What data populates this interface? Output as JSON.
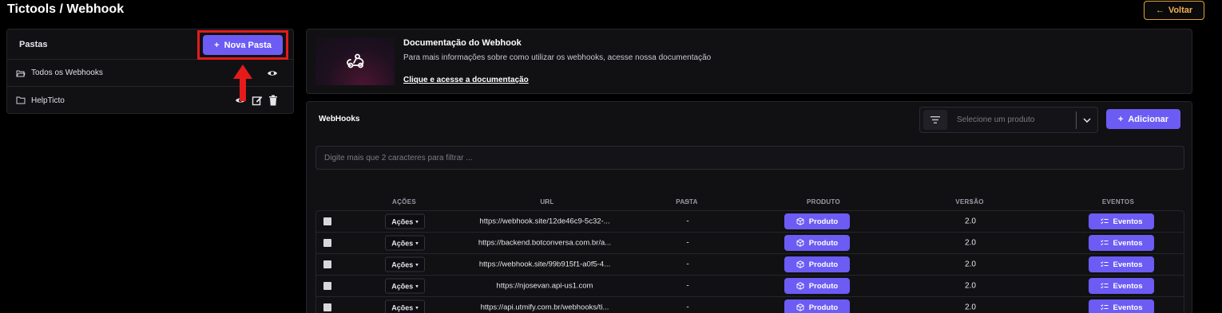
{
  "header": {
    "title": "Tictools / Webhook",
    "back_label": "Voltar"
  },
  "folders": {
    "title": "Pastas",
    "new_folder_label": "Nova Pasta",
    "items": [
      {
        "label": "Todos os Webhooks"
      },
      {
        "label": "HelpTicto"
      }
    ]
  },
  "doc": {
    "title": "Documentação do Webhook",
    "description": "Para mais informações sobre como utilizar os webhooks, acesse nossa documentação",
    "link_label": "Clique e acesse a documentação"
  },
  "webhooks": {
    "title": "WebHooks",
    "product_select_placeholder": "Selecione um produto",
    "add_label": "Adicionar",
    "filter_placeholder": "Digite mais que 2 caracteres para filtrar ...",
    "columns": {
      "acoes": "AÇÕES",
      "url": "URL",
      "pasta": "PASTA",
      "produto": "PRODUTO",
      "versao": "VERSÃO",
      "eventos": "EVENTOS"
    },
    "rows": [
      {
        "actions_label": "Ações",
        "url": "https://webhook.site/12de46c9-5c32-...",
        "folder": "-",
        "product_label": "Produto",
        "version": "2.0",
        "events_label": "Eventos"
      },
      {
        "actions_label": "Ações",
        "url": "https://backend.botconversa.com.br/a...",
        "folder": "-",
        "product_label": "Produto",
        "version": "2.0",
        "events_label": "Eventos"
      },
      {
        "actions_label": "Ações",
        "url": "https://webhook.site/99b915f1-a0f5-4...",
        "folder": "-",
        "product_label": "Produto",
        "version": "2.0",
        "events_label": "Eventos"
      },
      {
        "actions_label": "Ações",
        "url": "https://njosevan.api-us1.com",
        "folder": "-",
        "product_label": "Produto",
        "version": "2.0",
        "events_label": "Eventos"
      },
      {
        "actions_label": "Ações",
        "url": "https://api.utmify.com.br/webhooks/ti...",
        "folder": "-",
        "product_label": "Produto",
        "version": "2.0",
        "events_label": "Eventos"
      }
    ]
  },
  "colors": {
    "accent": "#6c5cf4",
    "back_border": "#e0a040",
    "highlight": "#e51b1b"
  }
}
